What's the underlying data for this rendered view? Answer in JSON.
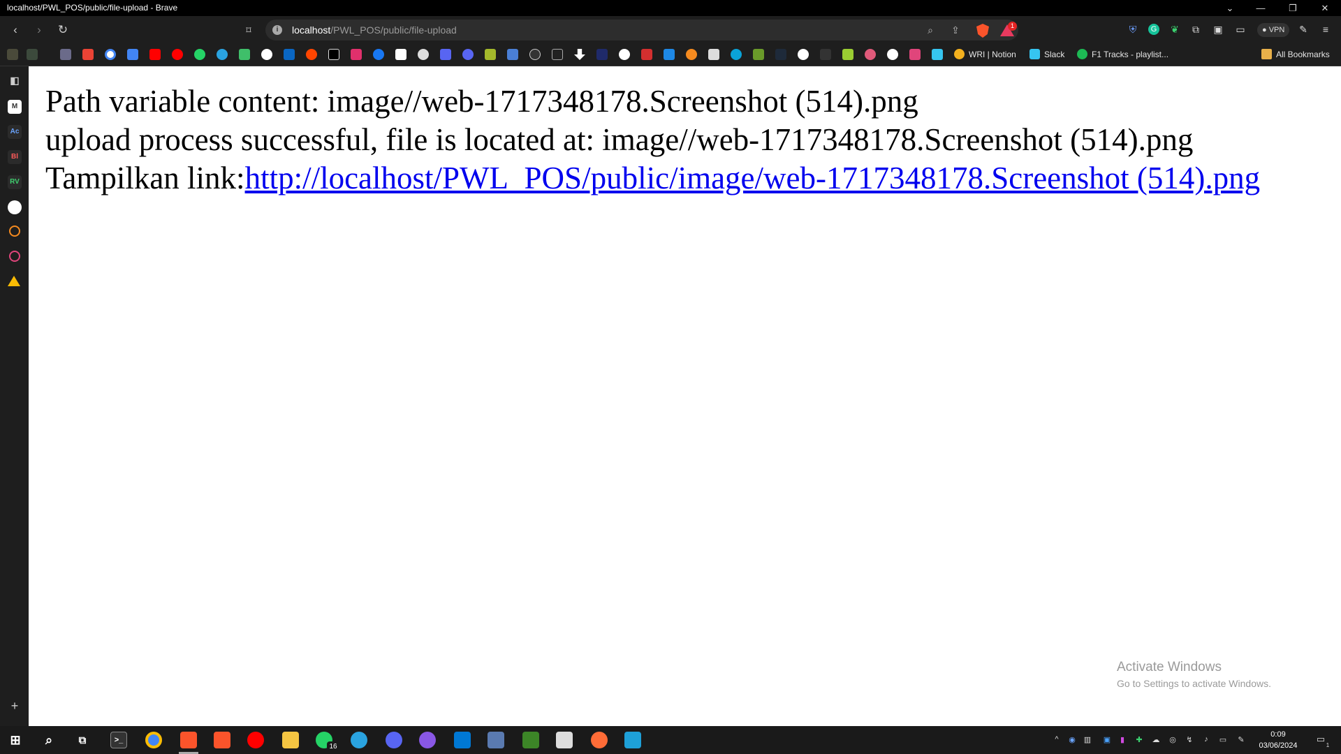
{
  "window": {
    "title": "localhost/PWL_POS/public/file-upload - Brave"
  },
  "toolbar": {
    "url_host": "localhost",
    "url_path": "/PWL_POS/public/file-upload",
    "rewards_count": "1",
    "vpn_label": "VPN"
  },
  "bookmarks": {
    "notion_label": "WRI | Notion",
    "slack_label": "Slack",
    "spotify_label": "F1 Tracks - playlist...",
    "all_label": "All Bookmarks"
  },
  "sidepanel": {
    "items": [
      "M",
      "Ac",
      "Bl",
      "RV"
    ]
  },
  "page": {
    "line1": "Path variable content: image//web-1717348178.Screenshot (514).png",
    "line2": "upload process successful, file is located at: image//web-1717348178.Screenshot (514).png",
    "line3_prefix": "Tampilkan link:",
    "link_text": "http://localhost/PWL_POS/public/image/web-1717348178.Screenshot (514).png",
    "link_href": "http://localhost/PWL_POS/public/image/web-1717348178.Screenshot (514).png"
  },
  "watermark": {
    "title": "Activate Windows",
    "subtitle": "Go to Settings to activate Windows."
  },
  "taskbar": {
    "whatsapp_badge": "16",
    "time": "0:09",
    "date": "03/06/2024",
    "notification_count": "1"
  },
  "colors": {
    "link": "#0000ee",
    "brave": "#fb542b",
    "chrome_bg": "#1e1e1e"
  }
}
